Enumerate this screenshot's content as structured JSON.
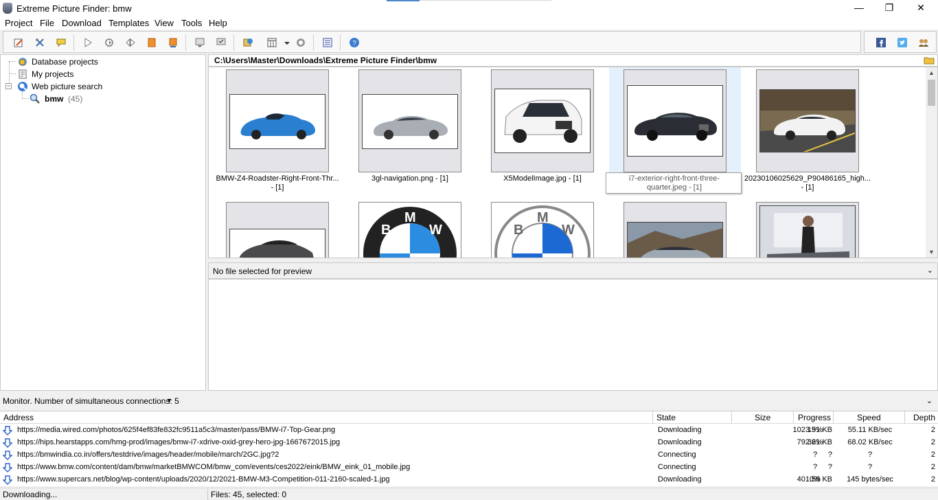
{
  "window": {
    "title": "Extreme Picture Finder: bmw",
    "minimize": "—",
    "maximize": "❐",
    "close": "✕"
  },
  "menu": [
    "Project",
    "File",
    "Download",
    "Templates",
    "View",
    "Tools",
    "Help"
  ],
  "toolbar_icons": [
    "new-project-icon",
    "edit-project-icon",
    "comment-icon",
    "start-icon",
    "refresh-icon",
    "step-icon",
    "stop-icon",
    "stop-all-icon",
    "download-list-icon",
    "download-selected-icon",
    "explore-icon",
    "view-mode-icon",
    "settings-icon",
    "schedule-icon",
    "help-icon"
  ],
  "social_icons": [
    "facebook-icon",
    "twitter-icon",
    "community-icon"
  ],
  "tree": {
    "database_projects": "Database projects",
    "my_projects": "My projects",
    "web_picture_search": "Web picture search",
    "search_bmw": "bmw",
    "search_bmw_count": "(45)"
  },
  "path": "C:\\Users\\Master\\Downloads\\Extreme Picture Finder\\bmw",
  "thumbnails": [
    {
      "caption_line1": "BMW-Z4-Roadster-Right-Front-Thr...",
      "caption_line2": "- [1]"
    },
    {
      "caption_line1": "3gl-navigation.png - [1]",
      "caption_line2": ""
    },
    {
      "caption_line1": "X5ModelImage.jpg - [1]",
      "caption_line2": ""
    },
    {
      "caption_line1": "i7-exterior-right-front-three-",
      "caption_line2": "quarter.jpeg - [1]"
    },
    {
      "caption_line1": "20230106025629_P90486165_high...",
      "caption_line2": "- [1]"
    }
  ],
  "logo_letters": {
    "b": "B",
    "m": "M",
    "w": "W"
  },
  "preview": {
    "text": "No file selected for preview"
  },
  "monitor": {
    "text": "Monitor. Number of simultaneous connections: 5"
  },
  "downloads": {
    "headers": {
      "address": "Address",
      "state": "State",
      "size": "Size",
      "progress": "Progress",
      "speed": "Speed",
      "depth": "Depth"
    },
    "rows": [
      {
        "address": "https://media.wired.com/photos/625f4ef83fe832fc9511a5c3/master/pass/BMW-i7-Top-Gear.png",
        "state": "Downloading",
        "size": "1023.51 KB",
        "progress": "19%",
        "speed": "55.11 KB/sec",
        "depth": "2"
      },
      {
        "address": "https://hips.hearstapps.com/hmg-prod/images/bmw-i7-xdrive-oxid-grey-hero-jpg-1667672015.jpg",
        "state": "Downloading",
        "size": "792.21 KB",
        "progress": "36%",
        "speed": "68.02 KB/sec",
        "depth": "2"
      },
      {
        "address": "https://bmwindia.co.in/offers/testdrive/images/header/mobile/march/2GC.jpg?2",
        "state": "Connecting",
        "size": "?",
        "progress": "?",
        "speed": "?",
        "depth": "2"
      },
      {
        "address": "https://www.bmw.com/content/dam/bmw/marketBMWCOM/bmw_com/events/ces2022/eink/BMW_eink_01_mobile.jpg",
        "state": "Connecting",
        "size": "?",
        "progress": "?",
        "speed": "?",
        "depth": "2"
      },
      {
        "address": "https://www.supercars.net/blog/wp-content/uploads/2020/12/2021-BMW-M3-Competition-011-2160-scaled-1.jpg",
        "state": "Downloading",
        "size": "401.59 KB",
        "progress": "0%",
        "speed": "145 bytes/sec",
        "depth": "2"
      }
    ]
  },
  "status": {
    "left": "Downloading...",
    "right": "Files: 45, selected: 0"
  },
  "colors": {
    "accent": "#4a86c8",
    "selection": "#e4f0fb",
    "download_arrow": "#2a62c8"
  }
}
